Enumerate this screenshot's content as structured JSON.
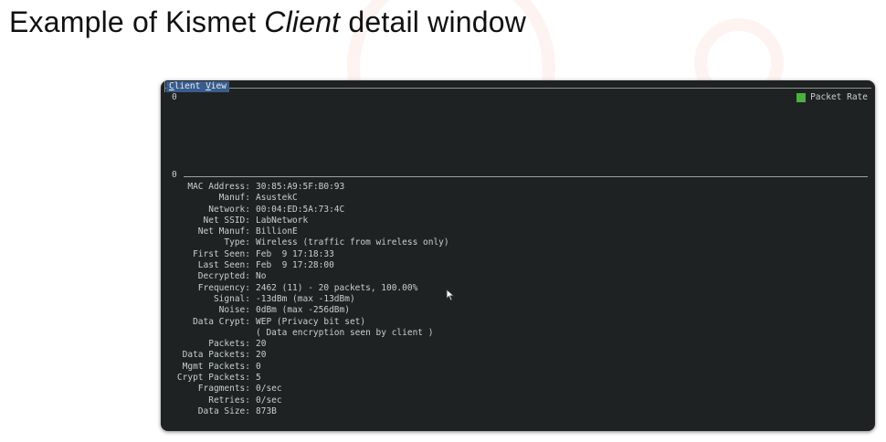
{
  "slide": {
    "title_prefix": "Example of Kismet ",
    "title_italic": "Client",
    "title_suffix": " detail window"
  },
  "window": {
    "title_first": "C",
    "title_mid": "lient ",
    "title_v": "V",
    "title_rest": "iew"
  },
  "graph": {
    "top_label": "0",
    "bottom_label": "0",
    "legend_label": "Packet Rate",
    "legend_color": "#4caf3f"
  },
  "details": [
    {
      "label": "MAC Address:",
      "value": "30:85:A9:5F:B0:93"
    },
    {
      "label": "Manuf:",
      "value": "AsustekC"
    },
    {
      "label": "Network:",
      "value": "00:04:ED:5A:73:4C"
    },
    {
      "label": "Net SSID:",
      "value": "LabNetwork"
    },
    {
      "label": "Net Manuf:",
      "value": "BillionE"
    },
    {
      "label": "Type:",
      "value": "Wireless (traffic from wireless only)"
    },
    {
      "label": "First Seen:",
      "value": "Feb  9 17:18:33"
    },
    {
      "label": "Last Seen:",
      "value": "Feb  9 17:28:00"
    },
    {
      "label": "Decrypted:",
      "value": "No"
    },
    {
      "label": "Frequency:",
      "value": "2462 (11) - 20 packets, 100.00%"
    },
    {
      "label": "Signal:",
      "value": "-13dBm (max -13dBm)"
    },
    {
      "label": "Noise:",
      "value": "0dBm (max -256dBm)"
    },
    {
      "label": "Data Crypt:",
      "value": "WEP (Privacy bit set)"
    },
    {
      "label": "",
      "value": "( Data encryption seen by client )"
    },
    {
      "label": "Packets:",
      "value": "20"
    },
    {
      "label": "Data Packets:",
      "value": "20"
    },
    {
      "label": "Mgmt Packets:",
      "value": "0"
    },
    {
      "label": "Crypt Packets:",
      "value": "5"
    },
    {
      "label": "Fragments:",
      "value": "0/sec"
    },
    {
      "label": "Retries:",
      "value": "0/sec"
    },
    {
      "label": "Data Size:",
      "value": "873B"
    }
  ]
}
